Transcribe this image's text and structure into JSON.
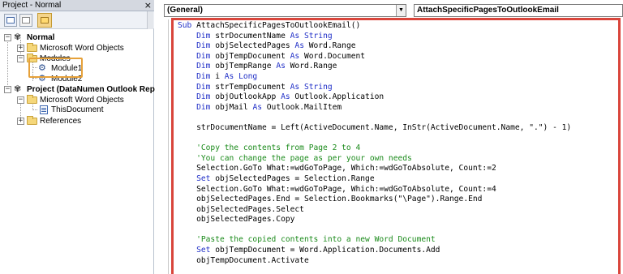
{
  "project_pane": {
    "title": "Project - Normal",
    "close_glyph": "×",
    "toolbar": {
      "view_code": "view-code-icon",
      "view_object": "view-object-icon",
      "toggle_folders": "toggle-folders-icon"
    },
    "tree": {
      "normal_project": "Normal",
      "word_objects_1": "Microsoft Word Objects",
      "modules_folder": "Modules",
      "module1": "Module1",
      "module2": "Module2",
      "project2": "Project (DataNumen Outlook Rep",
      "word_objects_2": "Microsoft Word Objects",
      "this_document": "ThisDocument",
      "references": "References"
    },
    "highlight_color": "#e6a13a"
  },
  "code_window": {
    "object_dropdown": "(General)",
    "procedure_dropdown": "AttachSpecificPagesToOutlookEmail",
    "frame_color": "#d9453b",
    "colors": {
      "keyword": "#1f2ec7",
      "comment": "#1a8a1a"
    },
    "lines": [
      [
        [
          "kw",
          "Sub "
        ],
        [
          "tx",
          "AttachSpecificPagesToOutlookEmail()"
        ]
      ],
      [
        [
          "kw",
          "    Dim "
        ],
        [
          "tx",
          "strDocumentName "
        ],
        [
          "kw",
          "As String"
        ]
      ],
      [
        [
          "kw",
          "    Dim "
        ],
        [
          "tx",
          "objSelectedPages "
        ],
        [
          "kw",
          "As "
        ],
        [
          "tx",
          "Word.Range"
        ]
      ],
      [
        [
          "kw",
          "    Dim "
        ],
        [
          "tx",
          "objTempDocument "
        ],
        [
          "kw",
          "As "
        ],
        [
          "tx",
          "Word.Document"
        ]
      ],
      [
        [
          "kw",
          "    Dim "
        ],
        [
          "tx",
          "objTempRange "
        ],
        [
          "kw",
          "As "
        ],
        [
          "tx",
          "Word.Range"
        ]
      ],
      [
        [
          "kw",
          "    Dim "
        ],
        [
          "tx",
          "i "
        ],
        [
          "kw",
          "As Long"
        ]
      ],
      [
        [
          "kw",
          "    Dim "
        ],
        [
          "tx",
          "strTempDocument "
        ],
        [
          "kw",
          "As String"
        ]
      ],
      [
        [
          "kw",
          "    Dim "
        ],
        [
          "tx",
          "objOutlookApp "
        ],
        [
          "kw",
          "As "
        ],
        [
          "tx",
          "Outlook.Application"
        ]
      ],
      [
        [
          "kw",
          "    Dim "
        ],
        [
          "tx",
          "objMail "
        ],
        [
          "kw",
          "As "
        ],
        [
          "tx",
          "Outlook.MailItem"
        ]
      ],
      [
        [
          "tx",
          ""
        ]
      ],
      [
        [
          "tx",
          "    strDocumentName = Left(ActiveDocument.Name, InStr(ActiveDocument.Name, \".\") - 1)"
        ]
      ],
      [
        [
          "tx",
          ""
        ]
      ],
      [
        [
          "cm",
          "    'Copy the contents from Page 2 to 4"
        ]
      ],
      [
        [
          "cm",
          "    'You can change the page as per your own needs"
        ]
      ],
      [
        [
          "tx",
          "    Selection.GoTo What:=wdGoToPage, Which:=wdGoToAbsolute, Count:=2"
        ]
      ],
      [
        [
          "kw",
          "    Set "
        ],
        [
          "tx",
          "objSelectedPages = Selection.Range"
        ]
      ],
      [
        [
          "tx",
          "    Selection.GoTo What:=wdGoToPage, Which:=wdGoToAbsolute, Count:=4"
        ]
      ],
      [
        [
          "tx",
          "    objSelectedPages.End = Selection.Bookmarks(\"\\Page\").Range.End"
        ]
      ],
      [
        [
          "tx",
          "    objSelectedPages.Select"
        ]
      ],
      [
        [
          "tx",
          "    objSelectedPages.Copy"
        ]
      ],
      [
        [
          "tx",
          ""
        ]
      ],
      [
        [
          "cm",
          "    'Paste the copied contents into a new Word Document"
        ]
      ],
      [
        [
          "kw",
          "    Set "
        ],
        [
          "tx",
          "objTempDocument = Word.Application.Documents.Add"
        ]
      ],
      [
        [
          "tx",
          "    objTempDocument.Activate"
        ]
      ]
    ]
  }
}
